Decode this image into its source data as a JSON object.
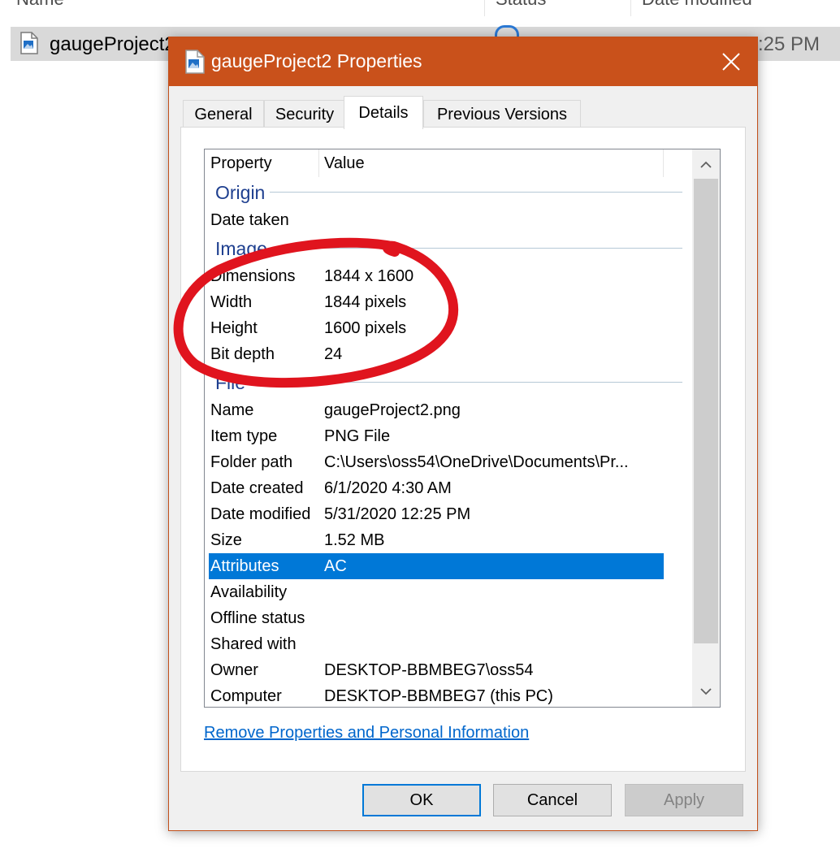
{
  "explorer": {
    "columns": {
      "name": "Name",
      "status": "Status",
      "date_modified": "Date modified"
    },
    "file_row": {
      "name": "gaugeProject2",
      "time": ":25 PM"
    }
  },
  "dialog": {
    "title": "gaugeProject2 Properties",
    "tabs": [
      {
        "label": "General"
      },
      {
        "label": "Security"
      },
      {
        "label": "Details"
      },
      {
        "label": "Previous Versions"
      }
    ],
    "active_tab": "Details",
    "list": {
      "header": {
        "property": "Property",
        "value": "Value"
      },
      "groups": {
        "origin": "Origin",
        "image": "Image",
        "file": "File"
      },
      "origin_rows": [
        {
          "prop": "Date taken",
          "val": ""
        }
      ],
      "image_rows": [
        {
          "prop": "Dimensions",
          "val": "1844 x 1600"
        },
        {
          "prop": "Width",
          "val": "1844 pixels"
        },
        {
          "prop": "Height",
          "val": "1600 pixels"
        },
        {
          "prop": "Bit depth",
          "val": "24"
        }
      ],
      "file_rows": [
        {
          "prop": "Name",
          "val": "gaugeProject2.png"
        },
        {
          "prop": "Item type",
          "val": "PNG File"
        },
        {
          "prop": "Folder path",
          "val": "C:\\Users\\oss54\\OneDrive\\Documents\\Pr..."
        },
        {
          "prop": "Date created",
          "val": "6/1/2020 4:30 AM"
        },
        {
          "prop": "Date modified",
          "val": "5/31/2020 12:25 PM"
        },
        {
          "prop": "Size",
          "val": "1.52 MB"
        },
        {
          "prop": "Attributes",
          "val": "AC"
        },
        {
          "prop": "Availability",
          "val": ""
        },
        {
          "prop": "Offline status",
          "val": ""
        },
        {
          "prop": "Shared with",
          "val": ""
        },
        {
          "prop": "Owner",
          "val": "DESKTOP-BBMBEG7\\oss54"
        },
        {
          "prop": "Computer",
          "val": "DESKTOP-BBMBEG7 (this PC)"
        }
      ],
      "selected_row": "Attributes"
    },
    "link": "Remove Properties and Personal Information",
    "buttons": {
      "ok": "OK",
      "cancel": "Cancel",
      "apply": "Apply"
    }
  },
  "colors": {
    "titlebar": "#c9511b",
    "selection": "#0078d7",
    "annotation": "#e0141e",
    "link": "#0066cc"
  },
  "icons": [
    "image-file-icon",
    "sync-status-icon",
    "close-icon",
    "chevron-up-icon",
    "chevron-down-icon"
  ]
}
